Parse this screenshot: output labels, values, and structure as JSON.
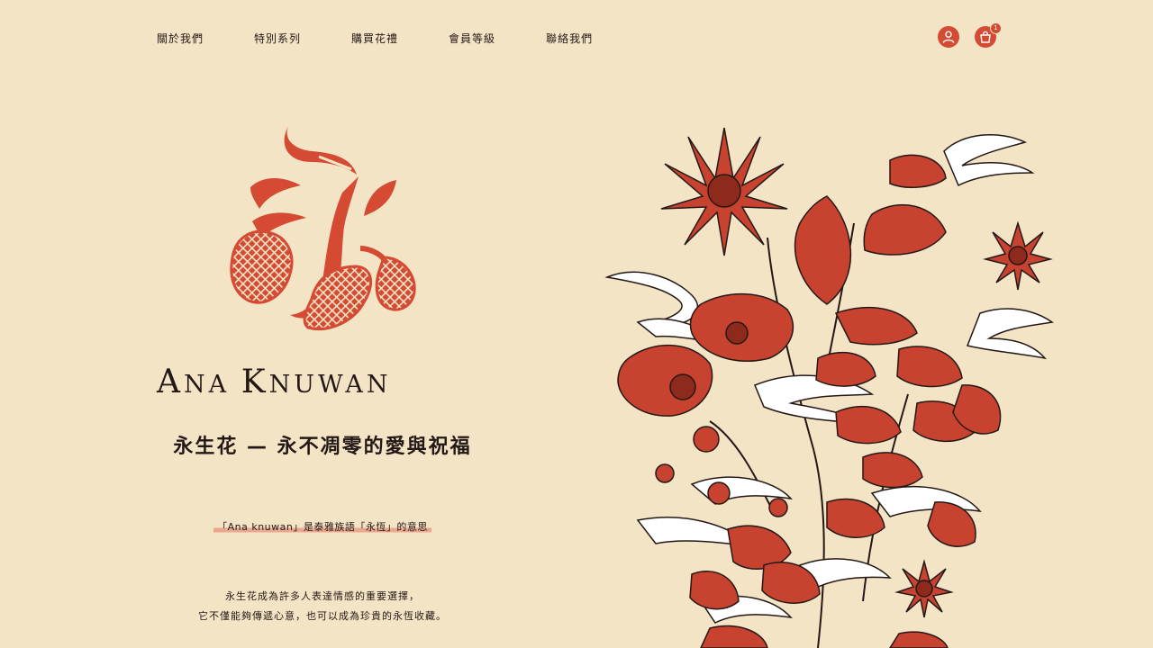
{
  "nav": {
    "items": [
      "關於我們",
      "特別系列",
      "購買花禮",
      "會員等級",
      "聯絡我們"
    ]
  },
  "header": {
    "account_icon": "user-icon",
    "cart_icon": "shopping-bag-icon",
    "cart_count": "1"
  },
  "hero": {
    "brand_parts": [
      "A",
      "NA ",
      "K",
      "NUWAN"
    ],
    "headline": "永生花 — 永不凋零的愛與祝福",
    "note": "「Ana knuwan」是泰雅族語「永恆」的意思",
    "body_lines": [
      "永生花成為許多人表達情感的重要選擇，",
      "它不僅能夠傳遞心意，也可以成為珍貴的永恆收藏。"
    ]
  },
  "colors": {
    "background": "#f4e4c6",
    "accent": "#d44a33",
    "text": "#231815"
  }
}
